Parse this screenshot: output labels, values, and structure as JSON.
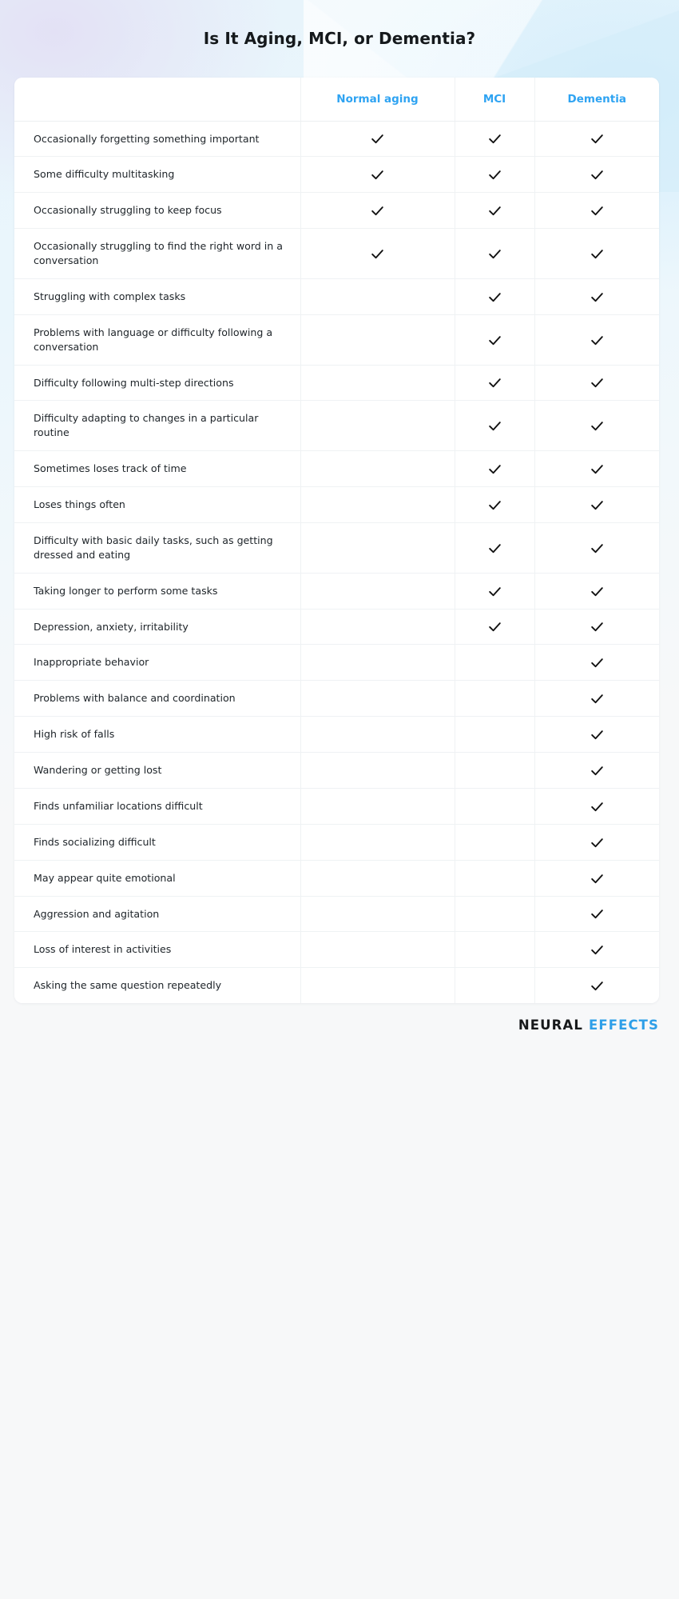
{
  "page": {
    "title": "Is It Aging, MCI, or Dementia?",
    "accent_color": "#2ea3f2",
    "background_color": "#f7f8f9",
    "card_background": "#ffffff",
    "check_color": "#111111"
  },
  "table": {
    "columns": [
      {
        "key": "label",
        "label": ""
      },
      {
        "key": "normal",
        "label": "Normal aging"
      },
      {
        "key": "mci",
        "label": "MCI"
      },
      {
        "key": "dementia",
        "label": "Dementia"
      }
    ],
    "rows": [
      {
        "label": "Occasionally forgetting something important",
        "normal": true,
        "mci": true,
        "dementia": true
      },
      {
        "label": "Some difficulty multitasking",
        "normal": true,
        "mci": true,
        "dementia": true
      },
      {
        "label": "Occasionally struggling to keep focus",
        "normal": true,
        "mci": true,
        "dementia": true
      },
      {
        "label": "Occasionally struggling to find the right word in a conversation",
        "normal": true,
        "mci": true,
        "dementia": true
      },
      {
        "label": "Struggling with complex tasks",
        "normal": false,
        "mci": true,
        "dementia": true
      },
      {
        "label": "Problems with language or difficulty following a conversation",
        "normal": false,
        "mci": true,
        "dementia": true
      },
      {
        "label": "Difficulty following multi-step directions",
        "normal": false,
        "mci": true,
        "dementia": true
      },
      {
        "label": "Difficulty adapting to changes in a particular routine",
        "normal": false,
        "mci": true,
        "dementia": true
      },
      {
        "label": "Sometimes loses track of time",
        "normal": false,
        "mci": true,
        "dementia": true
      },
      {
        "label": "Loses things often",
        "normal": false,
        "mci": true,
        "dementia": true
      },
      {
        "label": "Difficulty with basic daily tasks, such as getting dressed and eating",
        "normal": false,
        "mci": true,
        "dementia": true
      },
      {
        "label": "Taking longer to perform some tasks",
        "normal": false,
        "mci": true,
        "dementia": true
      },
      {
        "label": "Depression, anxiety, irritability",
        "normal": false,
        "mci": true,
        "dementia": true
      },
      {
        "label": "Inappropriate behavior",
        "normal": false,
        "mci": false,
        "dementia": true
      },
      {
        "label": "Problems with balance and coordination",
        "normal": false,
        "mci": false,
        "dementia": true
      },
      {
        "label": "High risk of falls",
        "normal": false,
        "mci": false,
        "dementia": true
      },
      {
        "label": "Wandering or getting lost",
        "normal": false,
        "mci": false,
        "dementia": true
      },
      {
        "label": "Finds unfamiliar locations difficult",
        "normal": false,
        "mci": false,
        "dementia": true
      },
      {
        "label": "Finds socializing difficult",
        "normal": false,
        "mci": false,
        "dementia": true
      },
      {
        "label": "May appear quite emotional",
        "normal": false,
        "mci": false,
        "dementia": true
      },
      {
        "label": "Aggression and agitation",
        "normal": false,
        "mci": false,
        "dementia": true
      },
      {
        "label": "Loss of interest in activities",
        "normal": false,
        "mci": false,
        "dementia": true
      },
      {
        "label": "Asking the same question repeatedly",
        "normal": false,
        "mci": false,
        "dementia": true
      }
    ]
  },
  "footer": {
    "logo_primary": "NEURAL",
    "logo_secondary": "EFFECTS"
  }
}
